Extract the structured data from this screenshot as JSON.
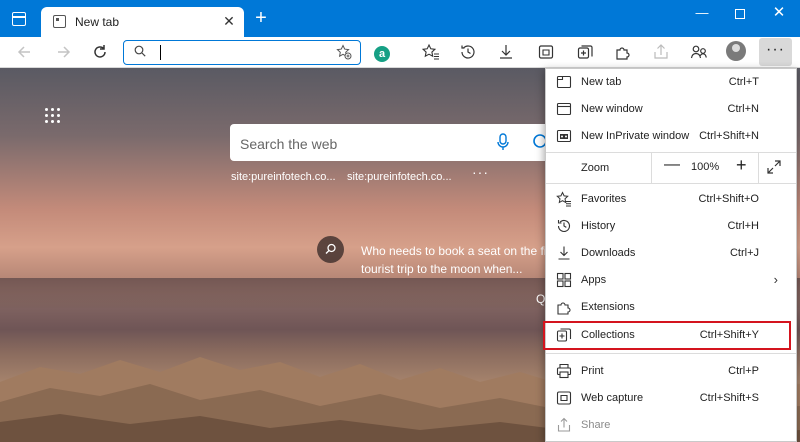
{
  "window": {
    "tab_title": "New tab",
    "tab_close_glyph": "✕",
    "new_tab_glyph": "+",
    "minimize_glyph": "—",
    "close_glyph": "✕"
  },
  "toolbar": {
    "address_value": "",
    "icons": [
      "back-icon",
      "forward-icon",
      "refresh-icon",
      "search-icon",
      "add-favorite-icon",
      "extension-a-icon",
      "favorites-icon",
      "history-icon",
      "downloads-icon",
      "web-capture-icon",
      "collections-icon",
      "extensions-icon",
      "share-icon",
      "profile-switch-icon",
      "avatar",
      "more-icon"
    ],
    "extension_letter": "a",
    "more_glyph": "···"
  },
  "newtab": {
    "search_placeholder": "Search the web",
    "quicklinks": [
      "site:pureinfotech.co...",
      "site:pureinfotech.co..."
    ],
    "quicklinks_more": "···",
    "story_text": "Who needs to book a seat on the fi... tourist trip to the moon when...",
    "story_partial": "Q"
  },
  "menu": {
    "section1": [
      {
        "label": "New tab",
        "shortcut": "Ctrl+T",
        "icon": "new-tab-icon"
      },
      {
        "label": "New window",
        "shortcut": "Ctrl+N",
        "icon": "new-window-icon"
      },
      {
        "label": "New InPrivate window",
        "shortcut": "Ctrl+Shift+N",
        "icon": "inprivate-icon"
      }
    ],
    "zoom": {
      "label": "Zoom",
      "value": "100%",
      "minus": "—",
      "plus": "+"
    },
    "section2": [
      {
        "label": "Favorites",
        "shortcut": "Ctrl+Shift+O",
        "icon": "favorites-icon"
      },
      {
        "label": "History",
        "shortcut": "Ctrl+H",
        "icon": "history-icon"
      },
      {
        "label": "Downloads",
        "shortcut": "Ctrl+J",
        "icon": "downloads-icon"
      },
      {
        "label": "Apps",
        "shortcut": "",
        "icon": "apps-icon"
      },
      {
        "label": "Extensions",
        "shortcut": "",
        "icon": "extensions-icon"
      },
      {
        "label": "Collections",
        "shortcut": "Ctrl+Shift+Y",
        "icon": "collections-icon"
      }
    ],
    "section3": [
      {
        "label": "Print",
        "shortcut": "Ctrl+P",
        "icon": "print-icon"
      },
      {
        "label": "Web capture",
        "shortcut": "Ctrl+Shift+S",
        "icon": "web-capture-icon"
      },
      {
        "label": "Share",
        "shortcut": "",
        "icon": "share-icon",
        "disabled": true
      }
    ],
    "apps_chevron": "›",
    "highlight_color": "#d4141e"
  },
  "colors": {
    "titlebar": "#0078d7",
    "accent": "#0078d7"
  }
}
